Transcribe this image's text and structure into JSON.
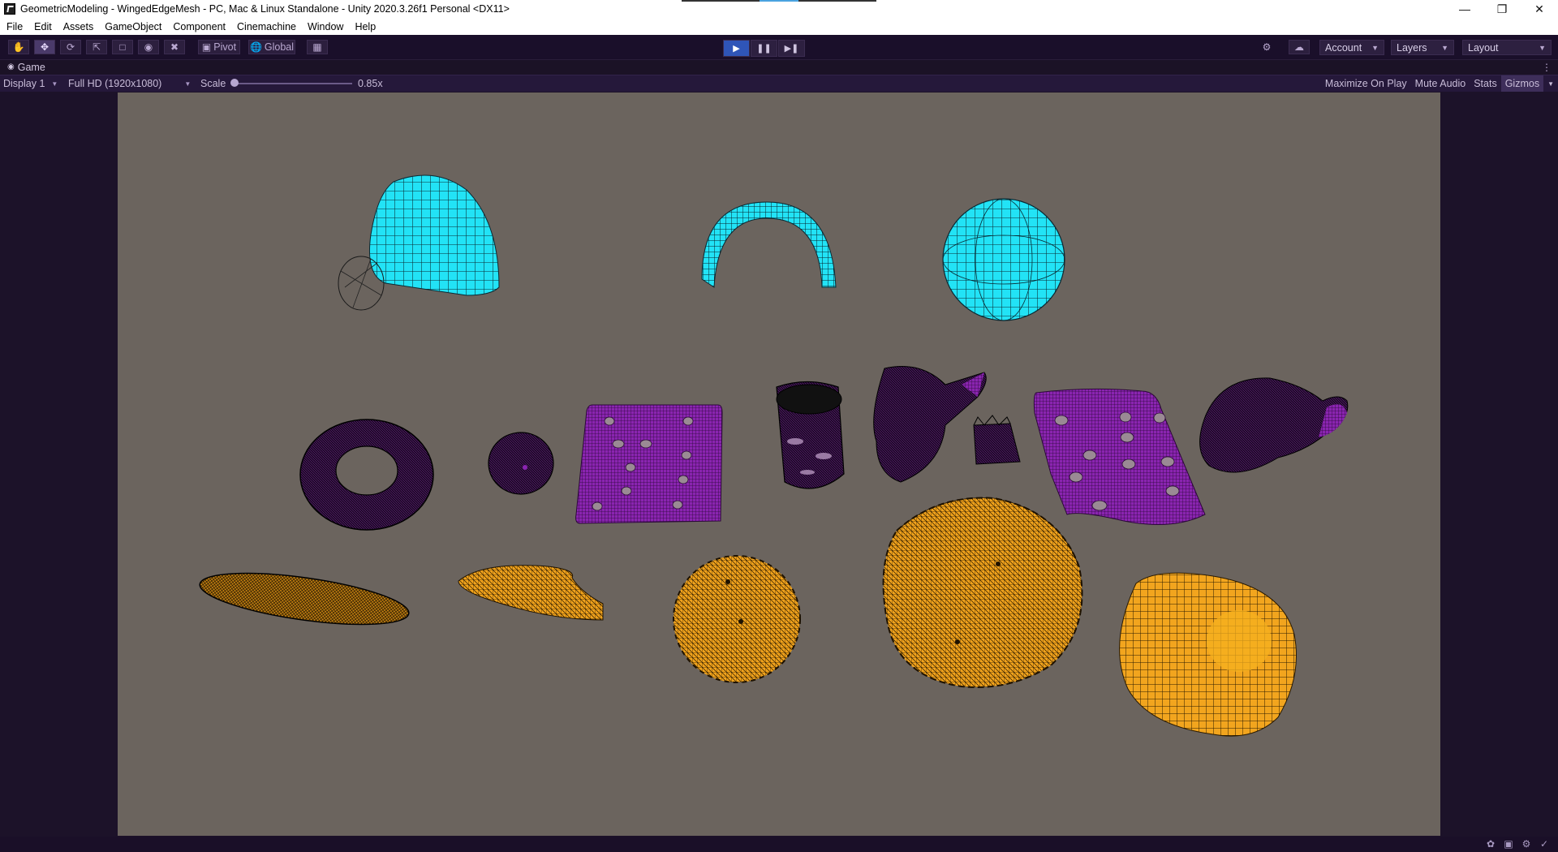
{
  "window": {
    "title": "GeometricModeling - WingedEdgeMesh - PC, Mac & Linux Standalone - Unity 2020.3.26f1 Personal <DX11>",
    "minimize_icon": "minimize-icon",
    "maximize_icon": "restore-icon",
    "close_icon": "close-icon"
  },
  "menu": {
    "items": [
      "File",
      "Edit",
      "Assets",
      "GameObject",
      "Component",
      "Cinemachine",
      "Window",
      "Help"
    ]
  },
  "toolbar": {
    "tools": [
      "hand-tool-icon",
      "move-tool-icon",
      "rotate-tool-icon",
      "scale-tool-icon",
      "rect-tool-icon",
      "transform-tool-icon",
      "custom-tool-icon"
    ],
    "pivot_label": "Pivot",
    "global_label": "Global",
    "grid_snap_icon": "grid-snap-icon",
    "play_state": "playing",
    "account_label": "Account",
    "layers_label": "Layers",
    "layout_label": "Layout"
  },
  "game_tab": {
    "label": "Game"
  },
  "game_view": {
    "display": "Display 1",
    "resolution": "Full HD (1920x1080)",
    "scale_label": "Scale",
    "scale_value": "0.85x",
    "maximize_on_play": "Maximize On Play",
    "mute_audio": "Mute Audio",
    "stats": "Stats",
    "gizmos": "Gizmos"
  },
  "scene": {
    "background_color": "#6b645e",
    "mesh_colors": {
      "cyan": "#22e3f6",
      "purple": "#8a24b0",
      "orange": "#f0a21c",
      "wire": "#000000"
    },
    "objects": [
      "cyan-surface-patch",
      "cyan-half-cylinder",
      "cyan-sphere",
      "purple-torus",
      "purple-small-sphere",
      "purple-plate-with-holes",
      "purple-cylinder-with-holes",
      "purple-hand-model",
      "purple-small-block",
      "purple-wavy-plate",
      "purple-twisted-knot",
      "orange-flat-disc",
      "orange-curved-leaf",
      "orange-star-disc",
      "orange-gear-blob",
      "orange-rounded-box"
    ]
  }
}
